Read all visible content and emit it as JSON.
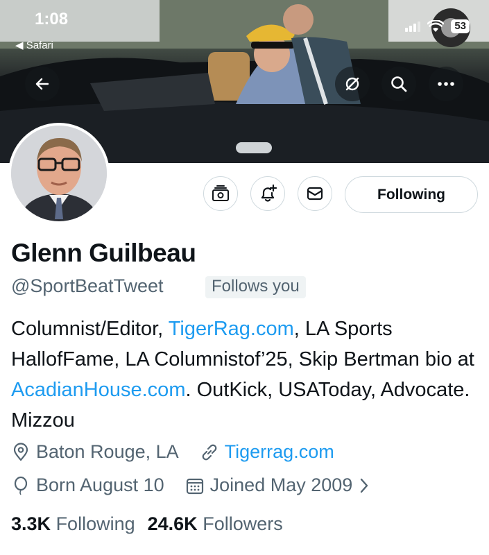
{
  "status_bar": {
    "time": "1:08",
    "back_app": "◀ Safari",
    "battery": "53"
  },
  "profile": {
    "name": "Glenn Guilbeau",
    "handle": "@SportBeatTweet",
    "follows_you": "Follows you",
    "follow_button": "Following",
    "bio": {
      "p1": "Columnist/Editor, ",
      "link1": "TigerRag.com",
      "p2": ", LA Sports HallofFame, LA Columnistof’25, Skip Bertman bio at ",
      "link2": "AcadianHouse.com",
      "p3": ". OutKick, USAToday, Advocate. Mizzou"
    },
    "location": "Baton Rouge, LA",
    "website": "Tigerrag.com",
    "birthday": "Born August 10",
    "joined": "Joined May 2009",
    "following_count": "3.3K",
    "following_label": "Following",
    "followers_count": "24.6K",
    "followers_label": "Followers"
  },
  "icons": [
    "back-arrow-icon",
    "grok-icon",
    "search-icon",
    "more-icon",
    "subscribe-icon",
    "notification-bell-icon",
    "message-icon",
    "location-icon",
    "link-icon",
    "balloon-icon",
    "calendar-icon",
    "chevron-right-icon"
  ],
  "colors": {
    "link": "#1d9bf0",
    "secondary_text": "#536471",
    "border": "#cfd9de"
  }
}
